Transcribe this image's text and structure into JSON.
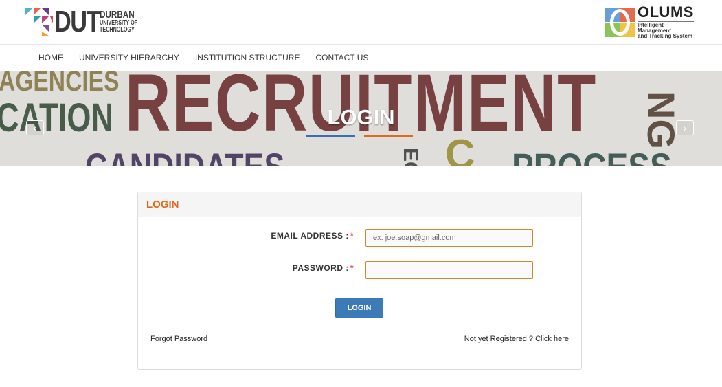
{
  "header": {
    "dut_logo": {
      "word": "DUT",
      "line1": "DURBAN",
      "line2": "UNIVERSITY OF",
      "line3": "TECHNOLOGY"
    },
    "olums_logo": {
      "brand": "OLUMS",
      "tag1": "Intelligent Management",
      "tag2": "and Tracking System"
    }
  },
  "nav": {
    "items": [
      {
        "label": "HOME"
      },
      {
        "label": "UNIVERSITY HIERARCHY"
      },
      {
        "label": "INSTITUTION STRUCTURE"
      },
      {
        "label": "CONTACT US"
      }
    ]
  },
  "banner": {
    "title": "LOGIN",
    "bg_words": {
      "recruitment": "RECRUITMENT",
      "agencies": "AGENCIES",
      "cation": "CATION",
      "candidates": "CANDIDATES",
      "process": "PROCESS",
      "c": "C",
      "ng": "NG",
      "ec": "EC"
    },
    "prev_icon": "‹",
    "next_icon": "›",
    "accent_blue": "#3a6db5",
    "accent_orange": "#e06a1a"
  },
  "login_panel": {
    "heading": "LOGIN",
    "email_label": "EMAIL ADDRESS :",
    "password_label": "PASSWORD :",
    "required_mark": "*",
    "email_placeholder": "ex. joe.soap@gmail.com",
    "email_value": "",
    "password_value": "",
    "submit_label": "LOGIN",
    "forgot_label": "Forgot Password",
    "register_label": "Not yet Registered ? Click here"
  }
}
